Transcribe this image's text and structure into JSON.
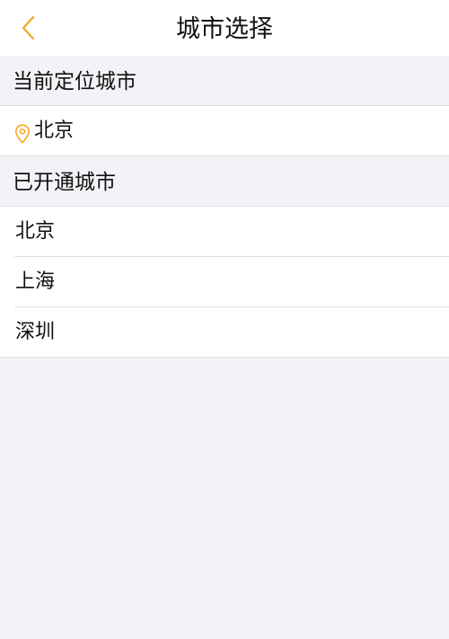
{
  "nav": {
    "title": "城市选择",
    "back_icon": "chevron-left-icon",
    "accent_color": "#f5a623"
  },
  "current_location": {
    "header": "当前定位城市",
    "icon": "location-pin-icon",
    "city": "北京"
  },
  "open_cities": {
    "header": "已开通城市",
    "items": [
      {
        "label": "北京"
      },
      {
        "label": "上海"
      },
      {
        "label": "深圳"
      }
    ]
  }
}
